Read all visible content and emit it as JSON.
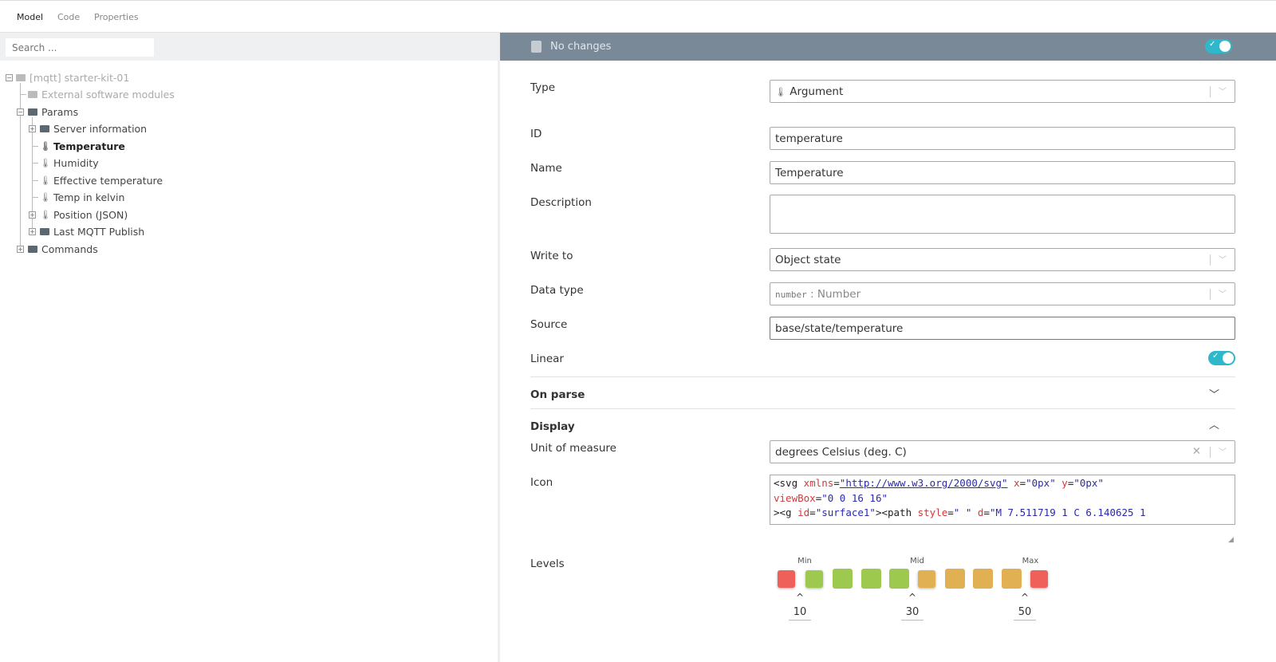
{
  "tabs": [
    "Model",
    "Code",
    "Properties"
  ],
  "search": {
    "placeholder": "Search ..."
  },
  "tree": {
    "root": "[mqtt] starter-kit-01",
    "external": "External software modules",
    "params": "Params",
    "children": [
      "Server information",
      "Temperature",
      "Humidity",
      "Effective temperature",
      "Temp in kelvin",
      "Position (JSON)",
      "Last MQTT Publish"
    ],
    "commands": "Commands"
  },
  "header": {
    "status": "No changes",
    "enabled": true
  },
  "form": {
    "type_label": "Type",
    "type_value": "Argument",
    "id_label": "ID",
    "id_value": "temperature",
    "name_label": "Name",
    "name_value": "Temperature",
    "description_label": "Description",
    "description_value": "",
    "write_label": "Write to",
    "write_value": "Object state",
    "datatype_label": "Data type",
    "datatype_code": "number",
    "datatype_value": ": Number",
    "source_label": "Source",
    "source_value": "base/state/temperature",
    "linear_label": "Linear",
    "linear_on": true,
    "onparse_label": "On parse",
    "display_label": "Display",
    "unit_label": "Unit of measure",
    "unit_value": "degrees Celsius (deg. C)",
    "icon_label": "Icon",
    "code": {
      "l1a": "<svg",
      "l1b": " xmlns",
      "l1c": "=",
      "l1d": "\"http://www.w3.org/2000/svg\"",
      "l1e": " x",
      "l1f": "=",
      "l1g": "\"0px\"",
      "l1h": " y",
      "l1i": "=",
      "l1j": "\"0px\"",
      "l2a": "viewBox",
      "l2b": "=",
      "l2c": "\"0 0 16 16\"",
      "l3a": "><g",
      "l3b": " id",
      "l3c": "=",
      "l3d": "\"surface1\"",
      "l3e": "><path",
      "l3f": " style",
      "l3g": "=",
      "l3h": "\" \"",
      "l3i": " d",
      "l3j": "=",
      "l3k": "\"M 7.511719 1 C 6.140625 1"
    },
    "levels_label": "Levels",
    "levels": {
      "min_label": "Min",
      "mid_label": "Mid",
      "max_label": "Max",
      "min": "10",
      "mid": "30",
      "max": "50",
      "colors": [
        "#f0605a",
        "#9dc94f",
        "#9dc94f",
        "#9dc94f",
        "#9dc94f",
        "#e0b052",
        "#e0b052",
        "#e0b052",
        "#e0b052",
        "#f0605a"
      ]
    }
  },
  "colors": {
    "accent": "#2fb8c9",
    "header": "#7a8997"
  }
}
